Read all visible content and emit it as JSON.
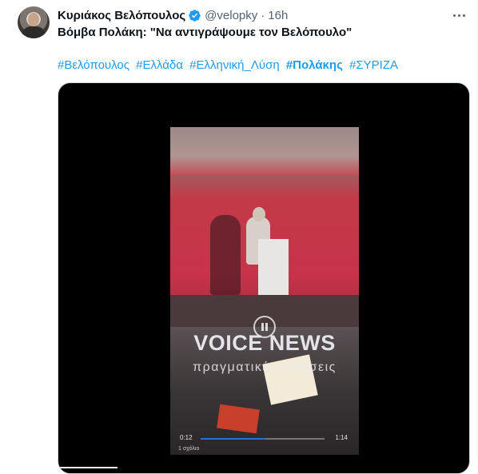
{
  "tweet": {
    "author_name": "Κυριάκος Βελόπουλος",
    "verified_icon": "verified-badge-icon",
    "handle": "@velopky",
    "separator": "·",
    "time": "16h",
    "text": "Βόμβα Πολάκη: \"Να αντιγράψουμε τον Βελόπουλο\"",
    "hashtags": [
      {
        "text": "#Βελόπουλος",
        "bold": false
      },
      {
        "text": "#Ελλάδα",
        "bold": false
      },
      {
        "text": "#Ελληνική_Λύση",
        "bold": false
      },
      {
        "text": "#Πολάκης",
        "bold": true
      },
      {
        "text": "#ΣΥΡΙΖΑ",
        "bold": false
      }
    ]
  },
  "video": {
    "logo_text": "VOICE NEWS",
    "logo_subtitle": "πραγματικές ειδήσεις",
    "elapsed": "0:12",
    "duration": "1:14",
    "progress": 0.52,
    "scrub_progress": 0.14,
    "reactions": "1 σχόλιο"
  },
  "colors": {
    "link": "#1d9bf0",
    "text": "#0f1419",
    "secondary": "#536471",
    "verified": "#1d9bf0"
  }
}
